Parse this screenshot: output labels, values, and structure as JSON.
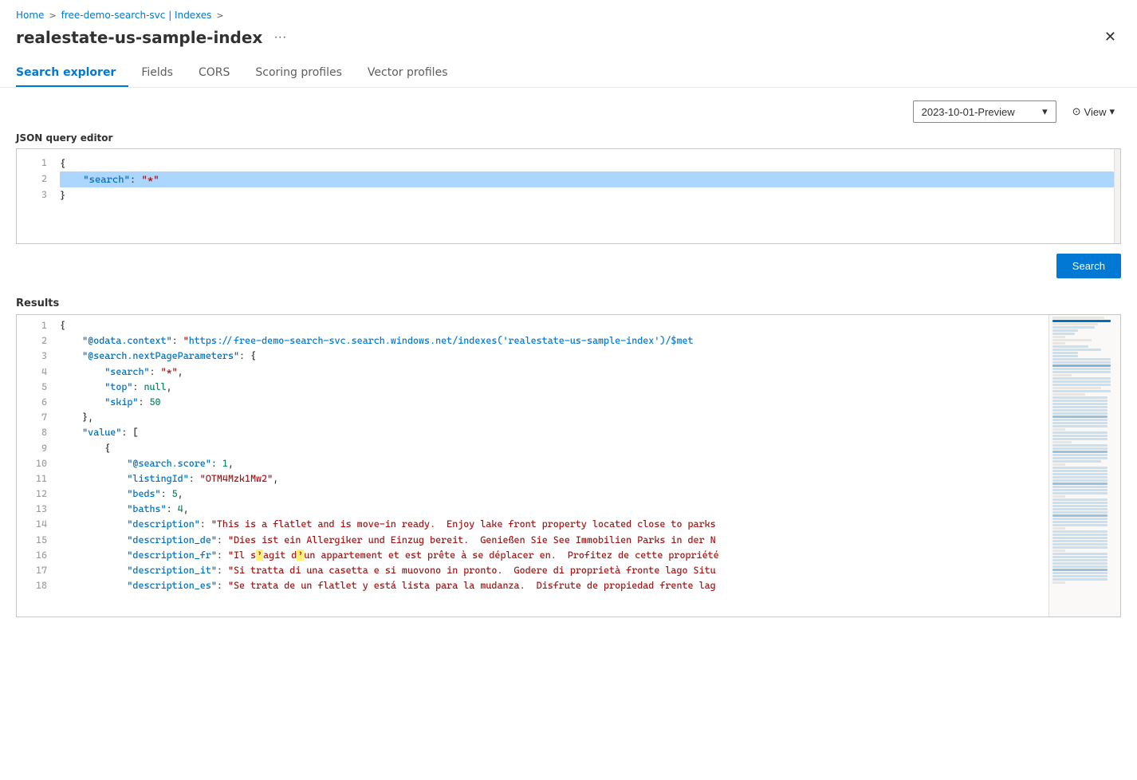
{
  "breadcrumb": {
    "home": "Home",
    "service": "free-demo-search-svc | Indexes",
    "separator1": ">",
    "separator2": ">",
    "current": ""
  },
  "page": {
    "title": "realestate-us-sample-index",
    "ellipsis": "···"
  },
  "tabs": [
    {
      "id": "search-explorer",
      "label": "Search explorer",
      "active": true
    },
    {
      "id": "fields",
      "label": "Fields",
      "active": false
    },
    {
      "id": "cors",
      "label": "CORS",
      "active": false
    },
    {
      "id": "scoring-profiles",
      "label": "Scoring profiles",
      "active": false
    },
    {
      "id": "vector-profiles",
      "label": "Vector profiles",
      "active": false
    }
  ],
  "toolbar": {
    "api_version": "2023-10-01-Preview",
    "view_label": "View",
    "chevron": "▾",
    "eye_icon": "⊙"
  },
  "editor": {
    "label": "JSON query editor",
    "lines": [
      {
        "num": 1,
        "content": "{"
      },
      {
        "num": 2,
        "content": "    \"search\": \"*\"",
        "highlight": true
      },
      {
        "num": 3,
        "content": "}"
      }
    ]
  },
  "search_button": "Search",
  "results": {
    "label": "Results",
    "lines": [
      {
        "num": 1,
        "content": "{"
      },
      {
        "num": 2,
        "content": "    \"@odata.context\": \"https://free-demo-search-svc.search.windows.net/indexes('realestate-us-sample-index')/$met",
        "has_link": true
      },
      {
        "num": 3,
        "content": "    \"@search.nextPageParameters\": {"
      },
      {
        "num": 4,
        "content": "        \"search\": \"*\","
      },
      {
        "num": 5,
        "content": "        \"top\": null,"
      },
      {
        "num": 6,
        "content": "        \"skip\": 50"
      },
      {
        "num": 7,
        "content": "    },"
      },
      {
        "num": 8,
        "content": "    \"value\": ["
      },
      {
        "num": 9,
        "content": "        {"
      },
      {
        "num": 10,
        "content": "            \"@search.score\": 1,"
      },
      {
        "num": 11,
        "content": "            \"listingId\": \"OTM4Mzk1Mw2\","
      },
      {
        "num": 12,
        "content": "            \"beds\": 5,"
      },
      {
        "num": 13,
        "content": "            \"baths\": 4,"
      },
      {
        "num": 14,
        "content": "            \"description\": \"This is a flatlet and is move-in ready.  Enjoy lake front property located close to parks"
      },
      {
        "num": 15,
        "content": "            \"description_de\": \"Dies ist ein Allergiker und Einzug bereit.  Genießen Sie See Immobilien Parks in der N"
      },
      {
        "num": 16,
        "content": "            \"description_fr\": \"Il s'agit d'un appartement et est prête à se déplacer en.  Profitez de cette propriété"
      },
      {
        "num": 17,
        "content": "            \"description_it\": \"Si tratta di una casetta e si muovono in pronto.  Godere di proprietà fronte lago Situ"
      },
      {
        "num": 18,
        "content": "            \"description_es\": \"Se trata de un flatlet y está lista para la mudanza.  Disfrute de propiedad frente lag"
      }
    ]
  }
}
